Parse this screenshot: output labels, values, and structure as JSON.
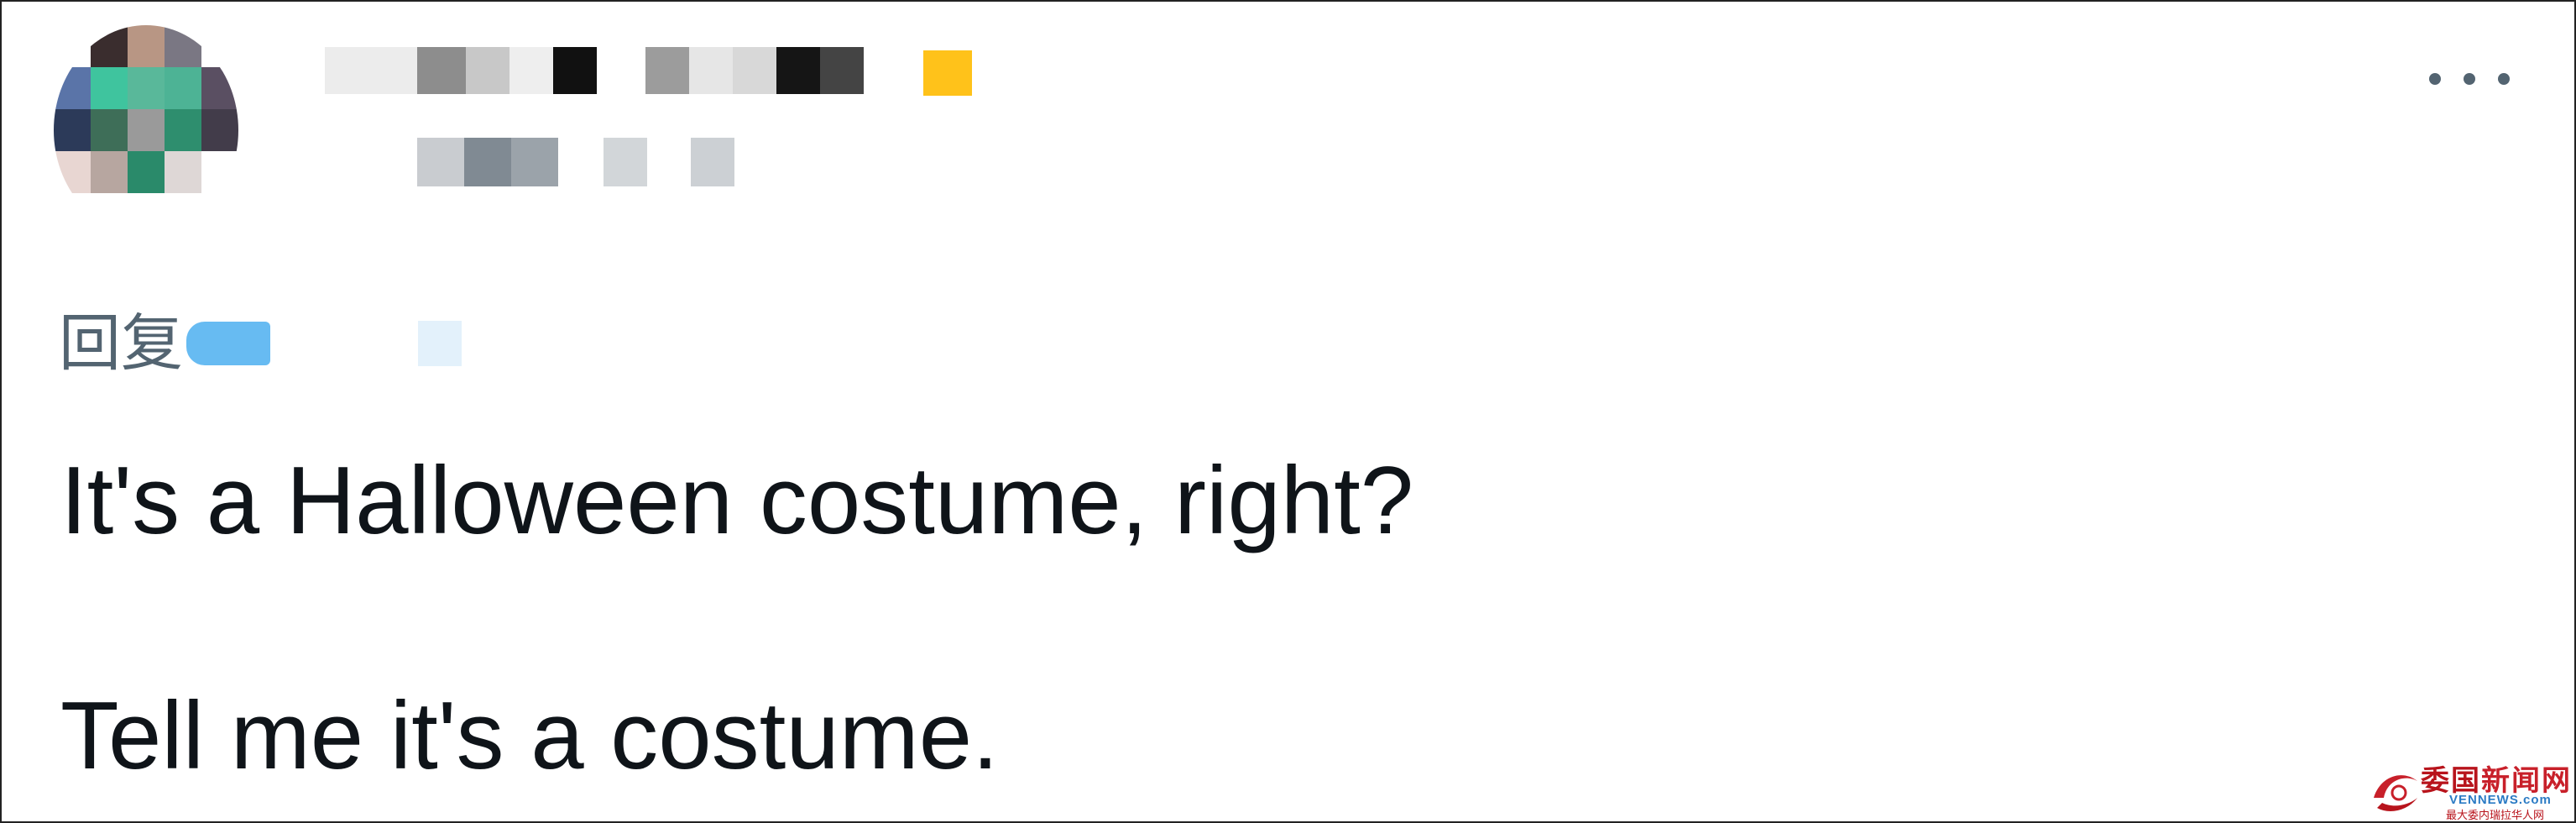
{
  "tweet": {
    "reply_prefix": "回复",
    "lines": [
      "It's a Halloween costume, right?",
      "Tell me it's a costume."
    ]
  },
  "icons": {
    "more": "more-horizontal-icon"
  },
  "colors": {
    "text_primary": "#0f1419",
    "text_secondary": "#536471",
    "mention_blue": "#1d9bf0",
    "verified_badge": "#ffc21a"
  },
  "watermark": {
    "title_part1": "委国",
    "title_part2": "新闻网",
    "domain": "VENNEWS.com",
    "slogan": "最大委内瑞拉华人网"
  }
}
